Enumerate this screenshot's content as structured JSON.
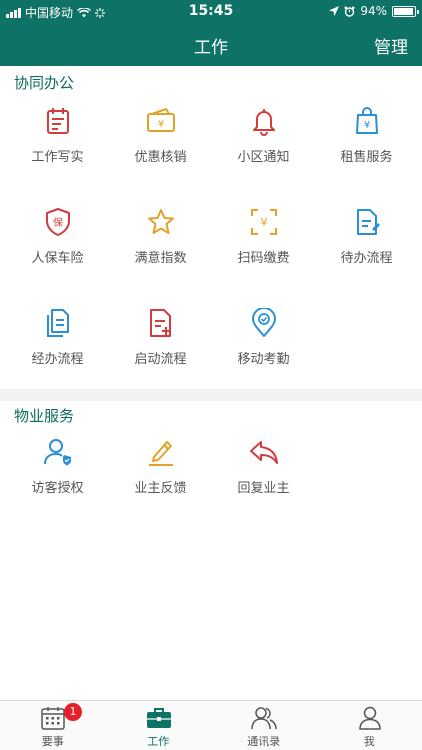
{
  "status_bar": {
    "carrier": "中国移动",
    "time": "15:45",
    "battery": "94%",
    "battery_level": 0.94
  },
  "nav": {
    "title": "工作",
    "manage_label": "管理"
  },
  "sections": [
    {
      "title": "协同办公",
      "items": [
        {
          "label": "工作写实",
          "icon": "notepad-icon",
          "color": "#d23c3c"
        },
        {
          "label": "优惠核销",
          "icon": "coupon-icon",
          "color": "#e3a12a"
        },
        {
          "label": "小区通知",
          "icon": "bell-icon",
          "color": "#d23c3c"
        },
        {
          "label": "租售服务",
          "icon": "shopping-bag-icon",
          "color": "#2b8fd6"
        },
        {
          "label": "人保车险",
          "icon": "insurance-shield-icon",
          "color": "#d23c3c"
        },
        {
          "label": "满意指数",
          "icon": "star-icon",
          "color": "#e3a12a"
        },
        {
          "label": "扫码缴费",
          "icon": "scan-pay-icon",
          "color": "#e3a12a"
        },
        {
          "label": "待办流程",
          "icon": "document-edit-icon",
          "color": "#2b8fd6"
        },
        {
          "label": "经办流程",
          "icon": "documents-icon",
          "color": "#2b8fd6"
        },
        {
          "label": "启动流程",
          "icon": "document-add-icon",
          "color": "#d23c3c"
        },
        {
          "label": "移动考勤",
          "icon": "location-check-icon",
          "color": "#2b8fd6"
        }
      ]
    },
    {
      "title": "物业服务",
      "items": [
        {
          "label": "访客授权",
          "icon": "visitor-auth-icon",
          "color": "#2b8fd6"
        },
        {
          "label": "业主反馈",
          "icon": "pencil-icon",
          "color": "#e3a12a"
        },
        {
          "label": "回复业主",
          "icon": "reply-icon",
          "color": "#d23c3c"
        }
      ]
    }
  ],
  "tabs": [
    {
      "label": "要事",
      "icon": "calendar-icon",
      "badge": "1",
      "active": false
    },
    {
      "label": "工作",
      "icon": "briefcase-icon",
      "active": true
    },
    {
      "label": "通讯录",
      "icon": "contacts-icon",
      "active": false
    },
    {
      "label": "我",
      "icon": "person-icon",
      "active": false
    }
  ],
  "colors": {
    "primary": "#0e7366",
    "red": "#d23c3c",
    "orange": "#e3a12a",
    "blue": "#2b8fd6",
    "badge": "#e5202b"
  }
}
